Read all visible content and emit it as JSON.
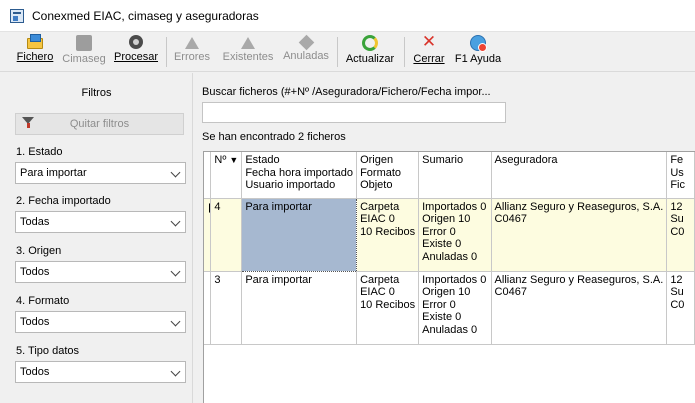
{
  "window": {
    "title": "Conexmed EIAC, cimaseg y aseguradoras"
  },
  "toolbar": {
    "fichero": "Fichero",
    "cimaseg": "Cimaseg",
    "procesar": "Procesar",
    "errores": "Errores",
    "existentes": "Existentes",
    "anuladas": "Anuladas",
    "actualizar": "Actualizar",
    "cerrar": "Cerrar",
    "ayuda": "F1 Ayuda"
  },
  "filters": {
    "title": "Filtros",
    "clear_label": "Quitar filtros",
    "items": [
      {
        "label": "1. Estado",
        "value": "Para importar"
      },
      {
        "label": "2. Fecha importado",
        "value": "Todas"
      },
      {
        "label": "3. Origen",
        "value": "Todos"
      },
      {
        "label": "4. Formato",
        "value": "Todos"
      },
      {
        "label": "5. Tipo datos",
        "value": "Todos"
      }
    ]
  },
  "search": {
    "label": "Buscar ficheros (#+Nº /Aseguradora/Fichero/Fecha impor...",
    "value": ""
  },
  "results": {
    "text": "Se han encontrado 2 ficheros"
  },
  "grid": {
    "headers": {
      "num": "Nº",
      "estado": [
        "Estado",
        "Fecha hora importado",
        "Usuario importado"
      ],
      "origen": [
        "Origen",
        "Formato",
        "Objeto"
      ],
      "sumario": [
        "Sumario"
      ],
      "aseguradora": [
        "Aseguradora"
      ],
      "last": [
        "Fe",
        "Us",
        "Fic"
      ]
    },
    "rows": [
      {
        "num": "4",
        "estado": [
          "Para importar"
        ],
        "origen": [
          "Carpeta",
          "EIAC 0",
          "10 Recibos"
        ],
        "sumario": [
          "Importados 0",
          "Origen 10",
          "Error 0",
          "Existe 0",
          "Anuladas 0"
        ],
        "aseguradora": [
          "Allianz Seguro y Reaseguros, S.A.",
          "C0467"
        ],
        "last": [
          "12",
          "Su",
          "C0"
        ]
      },
      {
        "num": "3",
        "estado": [
          "Para importar"
        ],
        "origen": [
          "Carpeta",
          "EIAC 0",
          "10 Recibos"
        ],
        "sumario": [
          "Importados 0",
          "Origen 10",
          "Error 0",
          "Existe 0",
          "Anuladas 0"
        ],
        "aseguradora": [
          "Allianz Seguro y Reaseguros, S.A.",
          "C0467"
        ],
        "last": [
          "12",
          "Su",
          "C0"
        ]
      }
    ]
  }
}
